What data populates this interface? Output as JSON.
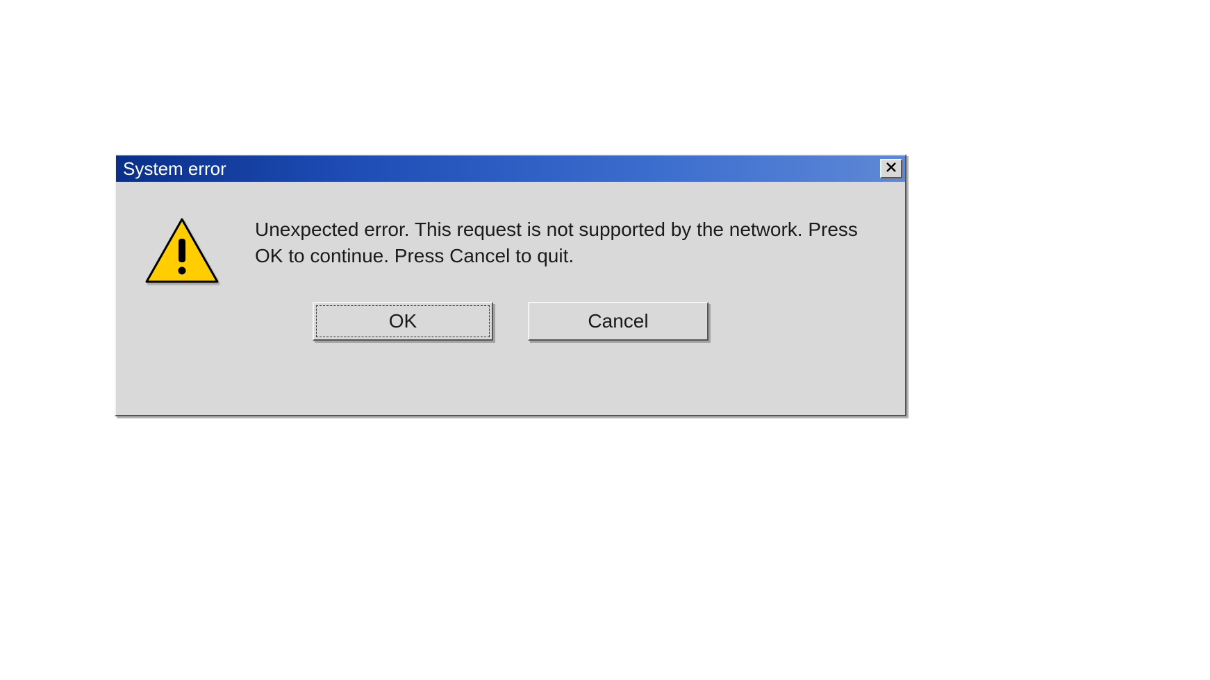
{
  "dialog": {
    "title": "System error",
    "message": "Unexpected error. This request is not supported by the network. Press OK to continue. Press Cancel to quit.",
    "buttons": {
      "ok_label": "OK",
      "cancel_label": "Cancel"
    },
    "close_icon": "close",
    "warning_icon": "warning-triangle"
  }
}
